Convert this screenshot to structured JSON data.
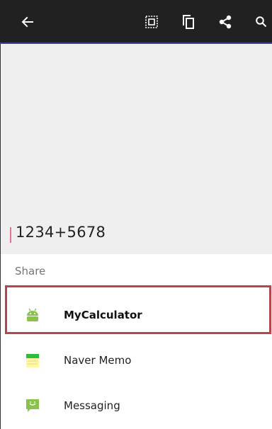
{
  "toolbar": {
    "icons": [
      "back-arrow-icon",
      "select-all-icon",
      "copy-icon",
      "share-icon",
      "search-icon"
    ],
    "background": "#212121",
    "accent_line": "#3a3f8f"
  },
  "editor": {
    "expression": "1234+5678",
    "cursor_color": "#e8738f"
  },
  "share_sheet": {
    "title": "Share",
    "apps": [
      {
        "label": "MyCalculator",
        "icon": "android-robot-icon",
        "selected": true
      },
      {
        "label": "Naver Memo",
        "icon": "naver-memo-icon",
        "selected": false
      },
      {
        "label": "Messaging",
        "icon": "messaging-icon",
        "selected": false
      }
    ],
    "highlight_color": "#b5474a"
  }
}
